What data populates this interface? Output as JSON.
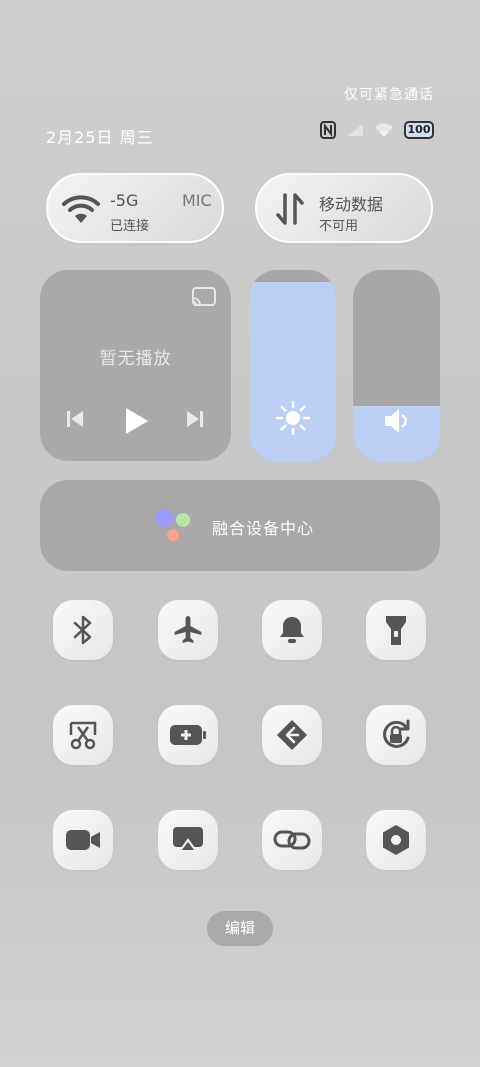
{
  "status": {
    "carrier_text": "仅可紧急通话",
    "date": "2月25日 周三",
    "battery": "100"
  },
  "wifi": {
    "ssid": "-5G",
    "ssid_tail": "MIC",
    "state": "已连接"
  },
  "mobile_data": {
    "label": "移动数据",
    "state": "不可用"
  },
  "media": {
    "title": "暂无播放"
  },
  "brightness": {
    "level": 0.94
  },
  "volume": {
    "level": 0.29
  },
  "fusion": {
    "label": "融合设备中心"
  },
  "toggles": [
    {
      "name": "bluetooth",
      "icon": "bluetooth-icon"
    },
    {
      "name": "airplane",
      "icon": "airplane-icon"
    },
    {
      "name": "bell",
      "icon": "bell-icon"
    },
    {
      "name": "flashlight",
      "icon": "flashlight-icon"
    },
    {
      "name": "screenshot",
      "icon": "scissors-icon"
    },
    {
      "name": "battery-saver",
      "icon": "battery-plus-icon"
    },
    {
      "name": "share",
      "icon": "share-icon"
    },
    {
      "name": "rotation-lock",
      "icon": "rotation-lock-icon"
    },
    {
      "name": "screen-record",
      "icon": "video-icon"
    },
    {
      "name": "screen-cast",
      "icon": "screencast-icon"
    },
    {
      "name": "link",
      "icon": "link-icon"
    },
    {
      "name": "settings",
      "icon": "hexagon-icon"
    }
  ],
  "edit": {
    "label": "编辑"
  },
  "colors": {
    "accent": "#bccff5",
    "panel": "#a8a8a8",
    "icon": "#555555"
  }
}
